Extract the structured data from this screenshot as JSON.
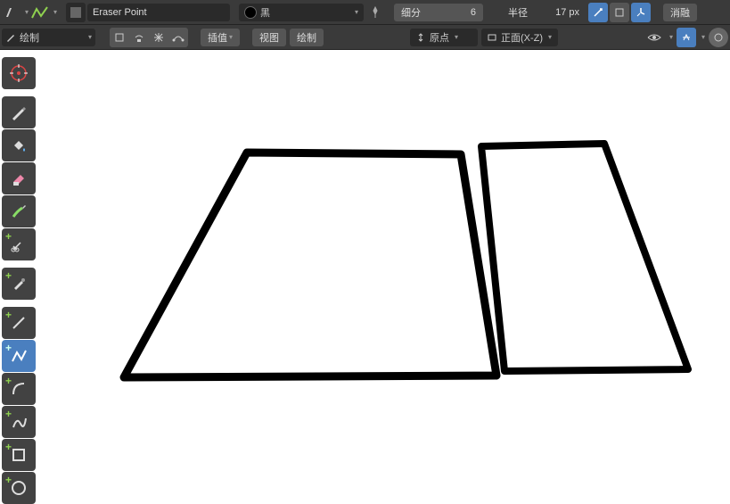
{
  "topbar": {
    "brush_name": "Eraser Point",
    "color_label": "黑",
    "subdivide_label": "细分",
    "subdivide_value": "6",
    "radius_label": "半径",
    "radius_value": "17 px",
    "dissolve_label": "消融"
  },
  "topbar2": {
    "mode_label": "绘制",
    "interpolate_label": "插值",
    "view_label": "视图",
    "draw_label": "绘制",
    "origin_label": "原点",
    "orientation_label": "正面(X-Z)"
  },
  "tools": {
    "cursor": "cursor",
    "draw": "draw",
    "fill": "fill",
    "erase": "erase",
    "tint": "tint",
    "cutter": "cutter",
    "eyedropper": "eyedropper",
    "line": "line",
    "polyline": "polyline",
    "arc": "arc",
    "curve": "curve",
    "box": "box",
    "circle": "circle"
  }
}
